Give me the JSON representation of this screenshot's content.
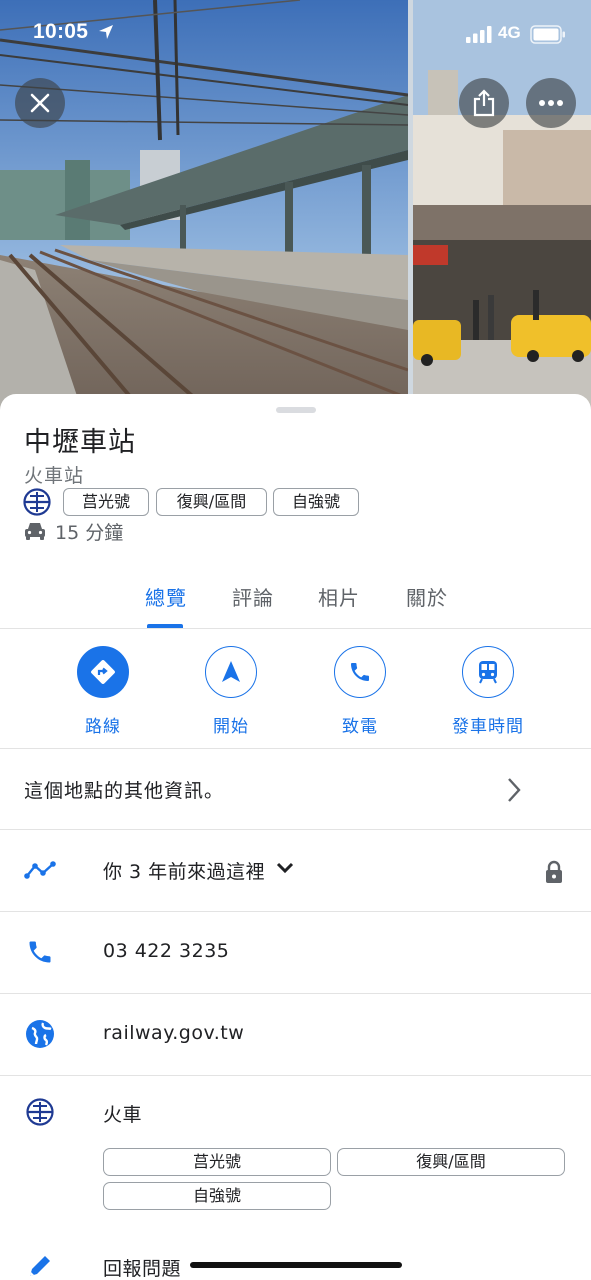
{
  "status_bar": {
    "time": "10:05",
    "network": "4G"
  },
  "header": {
    "close_icon": "close-icon",
    "share_icon": "share-icon",
    "more_icon": "more-horizontal-icon"
  },
  "place": {
    "name": "中壢車站",
    "category": "火車站",
    "service_chips": [
      "莒光號",
      "復興/區間",
      "自強號"
    ],
    "drive_time": "15 分鐘"
  },
  "tabs": [
    {
      "label": "總覽",
      "active": true
    },
    {
      "label": "評論",
      "active": false
    },
    {
      "label": "相片",
      "active": false
    },
    {
      "label": "關於",
      "active": false
    }
  ],
  "actions": [
    {
      "label": "路線",
      "icon": "directions-icon"
    },
    {
      "label": "開始",
      "icon": "navigation-arrow-icon"
    },
    {
      "label": "致電",
      "icon": "phone-icon"
    },
    {
      "label": "發車時間",
      "icon": "train-icon"
    }
  ],
  "more_info": {
    "text": "這個地點的其他資訊。"
  },
  "visit": {
    "text": "你 3 年前來過這裡"
  },
  "phone": {
    "number": "03 422 3235"
  },
  "website": {
    "url": "railway.gov.tw"
  },
  "transit": {
    "label": "火車",
    "chips": [
      "莒光號",
      "復興/區間",
      "自強號"
    ]
  },
  "report": {
    "text": "回報問題"
  },
  "colors": {
    "accent": "#1a73e8",
    "rail_logo": "#1f3a93",
    "divider": "#e3e3e3",
    "secondary_text": "#5f6368"
  }
}
